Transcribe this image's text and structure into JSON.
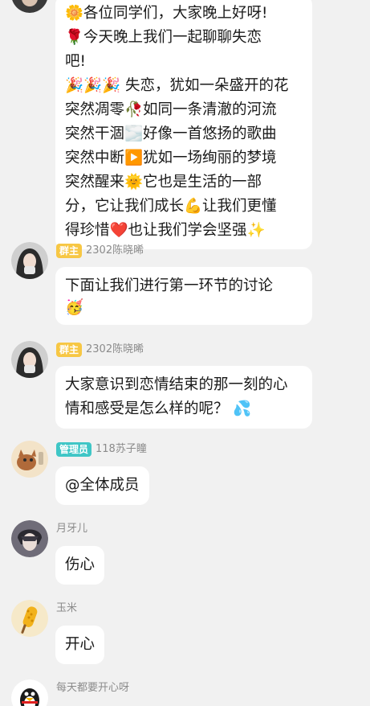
{
  "messages": [
    {
      "text_lines": [
        "🌼各位同学们，大家晚上好呀!",
        "🌹今天晚上我们一起聊聊失恋",
        "吧!",
        "🎉🎉🎉 失恋，犹如一朵盛开的花",
        "突然凋零🥀如同一条清澈的河流",
        "突然干涸🌫️好像一首悠扬的歌曲",
        "突然中断▶️犹如一场绚丽的梦境",
        "突然醒来🌞它也是生活的一部",
        "分，它让我们成长💪让我们更懂",
        "得珍惜❤️也让我们学会坚强✨"
      ]
    },
    {
      "badge": "群主",
      "sender": "2302陈晓晞",
      "text_lines": [
        "下面让我们进行第一环节的讨论",
        "🥳"
      ]
    },
    {
      "badge": "群主",
      "sender": "2302陈晓晞",
      "text_lines": [
        "大家意识到恋情结束的那一刻的心",
        "情和感受是怎么样的呢？ 💦"
      ]
    },
    {
      "badge": "管理员",
      "sender": "118苏子瞳",
      "text_lines": [
        "@全体成员"
      ]
    },
    {
      "sender": "月牙儿",
      "text_lines": [
        "伤心"
      ]
    },
    {
      "sender": "玉米",
      "text_lines": [
        "开心"
      ]
    },
    {
      "sender": "每天都要开心呀"
    }
  ],
  "colors": {
    "background": "#f1f1f1",
    "bubble": "#ffffff",
    "owner_badge": "#f7c744",
    "admin_badge": "#3fc6c6",
    "meta_text": "#8b8b8b"
  },
  "icons": {
    "avatar_0": "partial-avatar-icon",
    "avatar_1": "girl-avatar-icon",
    "avatar_2": "girl-avatar-icon",
    "avatar_3": "orange-cat-avatar-icon",
    "avatar_4": "anime-boy-avatar-icon",
    "avatar_5": "corn-avatar-icon",
    "avatar_6": "penguin-avatar-icon"
  }
}
